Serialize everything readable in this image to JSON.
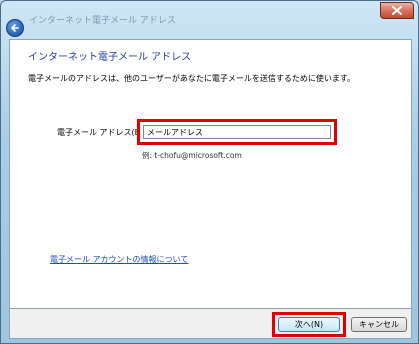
{
  "window": {
    "title": "インターネット電子メール アドレス"
  },
  "page": {
    "heading": "インターネット電子メール アドレス",
    "description": "電子メールのアドレスは、他のユーザーがあなたに電子メールを送信するために使います。",
    "email_label": "電子メール アドレス(E):",
    "email_value": "メールアドレス",
    "example": "例: t-chofu@microsoft.com",
    "info_link": "電子メール アカウントの情報について"
  },
  "footer": {
    "next_label": "次へ(N)",
    "cancel_label": "キャンセル"
  },
  "colors": {
    "highlight": "#e00000",
    "heading": "#1e3f9e",
    "link": "#1a50b8"
  }
}
